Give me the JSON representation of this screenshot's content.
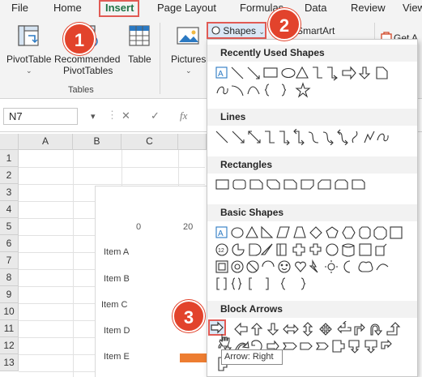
{
  "menu": {
    "tabs": [
      "File",
      "Home",
      "Insert",
      "Page Layout",
      "Formulas",
      "Data",
      "Review",
      "View"
    ]
  },
  "ribbon": {
    "pivottable_label": "PivotTable",
    "recommended_line1": "Recommended",
    "recommended_line2": "PivotTables",
    "table_label": "Table",
    "group_tables": "Tables",
    "pictures_label": "Pictures",
    "shapes_label": "Shapes",
    "smartart_label": "SmartArt",
    "get_addins_label": "Get A"
  },
  "formula_bar": {
    "name_box": "N7",
    "cancel_glyph": "✕",
    "enter_glyph": "✓",
    "fx_glyph": "fx"
  },
  "grid": {
    "columns": [
      "A",
      "B",
      "C"
    ],
    "rows": [
      "1",
      "2",
      "3",
      "4",
      "5",
      "6",
      "7",
      "8",
      "9",
      "10",
      "11",
      "12",
      "13"
    ]
  },
  "chart": {
    "ticks": [
      "0",
      "20"
    ]
  },
  "chart_data": {
    "type": "bar",
    "categories": [
      "Item A",
      "Item B",
      "Item  C",
      "Item D",
      "Item E"
    ],
    "xticks": [
      "0",
      "20"
    ],
    "values": [
      null,
      null,
      null,
      null,
      20
    ]
  },
  "shapes_menu": {
    "sections": [
      "Recently Used Shapes",
      "Lines",
      "Rectangles",
      "Basic Shapes",
      "Block Arrows"
    ],
    "tooltip": "Arrow: Right"
  },
  "badges": [
    "1",
    "2",
    "3"
  ],
  "colors": {
    "accent_green": "#217346",
    "highlight_red": "#e15b55",
    "badge_red": "#e2432c",
    "bar_orange": "#ed7d31"
  }
}
